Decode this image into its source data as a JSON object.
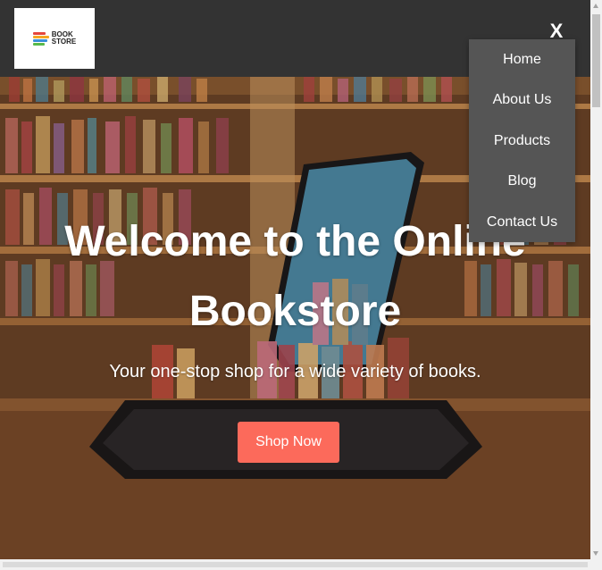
{
  "logo": {
    "line1": "BOOK",
    "line2": "STORE",
    "stripe_colors": [
      "#e5463b",
      "#f5a623",
      "#3a8fd9",
      "#58b94a"
    ]
  },
  "header": {
    "close_label": "X",
    "background": "#333333"
  },
  "nav": {
    "items": [
      {
        "label": "Home"
      },
      {
        "label": "About Us"
      },
      {
        "label": "Products"
      },
      {
        "label": "Blog"
      },
      {
        "label": "Contact Us"
      }
    ],
    "background": "#555555"
  },
  "hero": {
    "title_line1": "Welcome to the Online",
    "title_line2": "Bookstore",
    "subtitle": "Your one-stop shop for a wide variety of books.",
    "cta_label": "Shop Now",
    "cta_color": "#fc6a5b"
  }
}
